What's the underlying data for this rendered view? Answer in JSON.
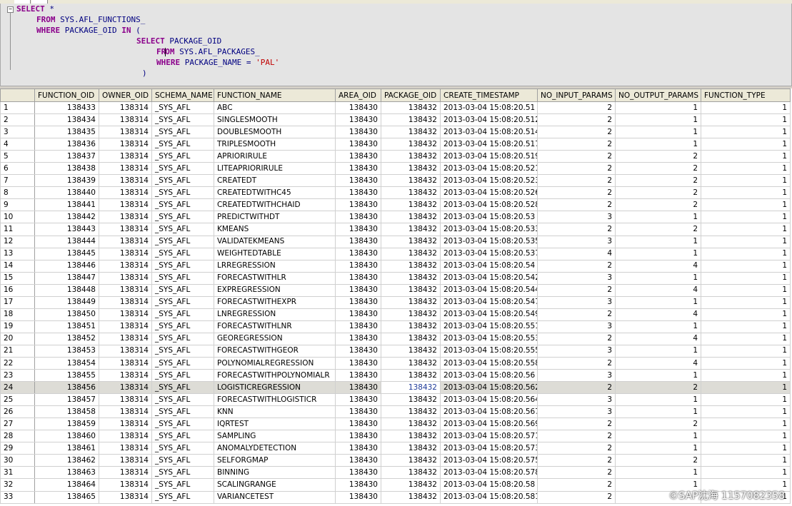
{
  "sql": {
    "line1_kw": "SELECT",
    "line1_rest": " *",
    "line2_kw": "FROM",
    "line2_rest": " SYS.AFL_FUNCTIONS_",
    "line3_kw1": "WHERE",
    "line3_mid": " PACKAGE_OID ",
    "line3_kw2": "IN",
    "line3_rest": " (",
    "line4_kw": "SELECT",
    "line4_rest": " PACKAGE_OID",
    "line5_kw_a": "FR",
    "line5_kw_b": "OM",
    "line5_rest": " SYS.AFL_PACKAGES_",
    "line6_kw": "WHERE",
    "line6_mid": " PACKAGE_NAME = ",
    "line6_str": "'PAL'",
    "line7": ")"
  },
  "grid": {
    "columns": [
      "",
      "FUNCTION_OID",
      "OWNER_OID",
      "SCHEMA_NAME",
      "FUNCTION_NAME",
      "AREA_OID",
      "PACKAGE_OID",
      "CREATE_TIMESTAMP",
      "NO_INPUT_PARAMS",
      "NO_OUTPUT_PARAMS",
      "FUNCTION_TYPE"
    ],
    "selected_row": 24,
    "rows": [
      [
        "1",
        "138433",
        "138314",
        "_SYS_AFL",
        "ABC",
        "138430",
        "138432",
        "2013-03-04 15:08:20.51",
        "2",
        "1",
        "1"
      ],
      [
        "2",
        "138434",
        "138314",
        "_SYS_AFL",
        "SINGLESMOOTH",
        "138430",
        "138432",
        "2013-03-04 15:08:20.512",
        "2",
        "1",
        "1"
      ],
      [
        "3",
        "138435",
        "138314",
        "_SYS_AFL",
        "DOUBLESMOOTH",
        "138430",
        "138432",
        "2013-03-04 15:08:20.514",
        "2",
        "1",
        "1"
      ],
      [
        "4",
        "138436",
        "138314",
        "_SYS_AFL",
        "TRIPLESMOOTH",
        "138430",
        "138432",
        "2013-03-04 15:08:20.517",
        "2",
        "1",
        "1"
      ],
      [
        "5",
        "138437",
        "138314",
        "_SYS_AFL",
        "APRIORIRULE",
        "138430",
        "138432",
        "2013-03-04 15:08:20.519",
        "2",
        "2",
        "1"
      ],
      [
        "6",
        "138438",
        "138314",
        "_SYS_AFL",
        "LITEAPRIORIRULE",
        "138430",
        "138432",
        "2013-03-04 15:08:20.521",
        "2",
        "2",
        "1"
      ],
      [
        "7",
        "138439",
        "138314",
        "_SYS_AFL",
        "CREATEDT",
        "138430",
        "138432",
        "2013-03-04 15:08:20.523",
        "2",
        "2",
        "1"
      ],
      [
        "8",
        "138440",
        "138314",
        "_SYS_AFL",
        "CREATEDTWITHC45",
        "138430",
        "138432",
        "2013-03-04 15:08:20.526",
        "2",
        "2",
        "1"
      ],
      [
        "9",
        "138441",
        "138314",
        "_SYS_AFL",
        "CREATEDTWITHCHAID",
        "138430",
        "138432",
        "2013-03-04 15:08:20.528",
        "2",
        "2",
        "1"
      ],
      [
        "10",
        "138442",
        "138314",
        "_SYS_AFL",
        "PREDICTWITHDT",
        "138430",
        "138432",
        "2013-03-04 15:08:20.53",
        "3",
        "1",
        "1"
      ],
      [
        "11",
        "138443",
        "138314",
        "_SYS_AFL",
        "KMEANS",
        "138430",
        "138432",
        "2013-03-04 15:08:20.533",
        "2",
        "2",
        "1"
      ],
      [
        "12",
        "138444",
        "138314",
        "_SYS_AFL",
        "VALIDATEKMEANS",
        "138430",
        "138432",
        "2013-03-04 15:08:20.535",
        "3",
        "1",
        "1"
      ],
      [
        "13",
        "138445",
        "138314",
        "_SYS_AFL",
        "WEIGHTEDTABLE",
        "138430",
        "138432",
        "2013-03-04 15:08:20.537",
        "4",
        "1",
        "1"
      ],
      [
        "14",
        "138446",
        "138314",
        "_SYS_AFL",
        "LRREGRESSION",
        "138430",
        "138432",
        "2013-03-04 15:08:20.54",
        "2",
        "4",
        "1"
      ],
      [
        "15",
        "138447",
        "138314",
        "_SYS_AFL",
        "FORECASTWITHLR",
        "138430",
        "138432",
        "2013-03-04 15:08:20.542",
        "3",
        "1",
        "1"
      ],
      [
        "16",
        "138448",
        "138314",
        "_SYS_AFL",
        "EXPREGRESSION",
        "138430",
        "138432",
        "2013-03-04 15:08:20.544",
        "2",
        "4",
        "1"
      ],
      [
        "17",
        "138449",
        "138314",
        "_SYS_AFL",
        "FORECASTWITHEXPR",
        "138430",
        "138432",
        "2013-03-04 15:08:20.547",
        "3",
        "1",
        "1"
      ],
      [
        "18",
        "138450",
        "138314",
        "_SYS_AFL",
        "LNREGRESSION",
        "138430",
        "138432",
        "2013-03-04 15:08:20.549",
        "2",
        "4",
        "1"
      ],
      [
        "19",
        "138451",
        "138314",
        "_SYS_AFL",
        "FORECASTWITHLNR",
        "138430",
        "138432",
        "2013-03-04 15:08:20.551",
        "3",
        "1",
        "1"
      ],
      [
        "20",
        "138452",
        "138314",
        "_SYS_AFL",
        "GEOREGRESSION",
        "138430",
        "138432",
        "2013-03-04 15:08:20.553",
        "2",
        "4",
        "1"
      ],
      [
        "21",
        "138453",
        "138314",
        "_SYS_AFL",
        "FORECASTWITHGEOR",
        "138430",
        "138432",
        "2013-03-04 15:08:20.555",
        "3",
        "1",
        "1"
      ],
      [
        "22",
        "138454",
        "138314",
        "_SYS_AFL",
        "POLYNOMIALREGRESSION",
        "138430",
        "138432",
        "2013-03-04 15:08:20.558",
        "2",
        "4",
        "1"
      ],
      [
        "23",
        "138455",
        "138314",
        "_SYS_AFL",
        "FORECASTWITHPOLYNOMIALR",
        "138430",
        "138432",
        "2013-03-04 15:08:20.56",
        "3",
        "1",
        "1"
      ],
      [
        "24",
        "138456",
        "138314",
        "_SYS_AFL",
        "LOGISTICREGRESSION",
        "138430",
        "138432",
        "2013-03-04 15:08:20.562",
        "2",
        "2",
        "1"
      ],
      [
        "25",
        "138457",
        "138314",
        "_SYS_AFL",
        "FORECASTWITHLOGISTICR",
        "138430",
        "138432",
        "2013-03-04 15:08:20.564",
        "3",
        "1",
        "1"
      ],
      [
        "26",
        "138458",
        "138314",
        "_SYS_AFL",
        "KNN",
        "138430",
        "138432",
        "2013-03-04 15:08:20.567",
        "3",
        "1",
        "1"
      ],
      [
        "27",
        "138459",
        "138314",
        "_SYS_AFL",
        "IQRTEST",
        "138430",
        "138432",
        "2013-03-04 15:08:20.569",
        "2",
        "2",
        "1"
      ],
      [
        "28",
        "138460",
        "138314",
        "_SYS_AFL",
        "SAMPLING",
        "138430",
        "138432",
        "2013-03-04 15:08:20.571",
        "2",
        "1",
        "1"
      ],
      [
        "29",
        "138461",
        "138314",
        "_SYS_AFL",
        "ANOMALYDETECTION",
        "138430",
        "138432",
        "2013-03-04 15:08:20.573",
        "2",
        "1",
        "1"
      ],
      [
        "30",
        "138462",
        "138314",
        "_SYS_AFL",
        "SELFORGMAP",
        "138430",
        "138432",
        "2013-03-04 15:08:20.575",
        "2",
        "2",
        "1"
      ],
      [
        "31",
        "138463",
        "138314",
        "_SYS_AFL",
        "BINNING",
        "138430",
        "138432",
        "2013-03-04 15:08:20.578",
        "2",
        "1",
        "1"
      ],
      [
        "32",
        "138464",
        "138314",
        "_SYS_AFL",
        "SCALINGRANGE",
        "138430",
        "138432",
        "2013-03-04 15:08:20.58",
        "2",
        "1",
        "1"
      ],
      [
        "33",
        "138465",
        "138314",
        "_SYS_AFL",
        "VARIANCETEST",
        "138430",
        "138432",
        "2013-03-04 15:08:20.581",
        "2",
        "",
        "1"
      ]
    ]
  },
  "watermark": "©SAP沈海 1157082358",
  "colors": {
    "keyword": "#8b008b",
    "identifier": "#000080",
    "string": "#c00000",
    "selected_row": "#dddcd6"
  }
}
